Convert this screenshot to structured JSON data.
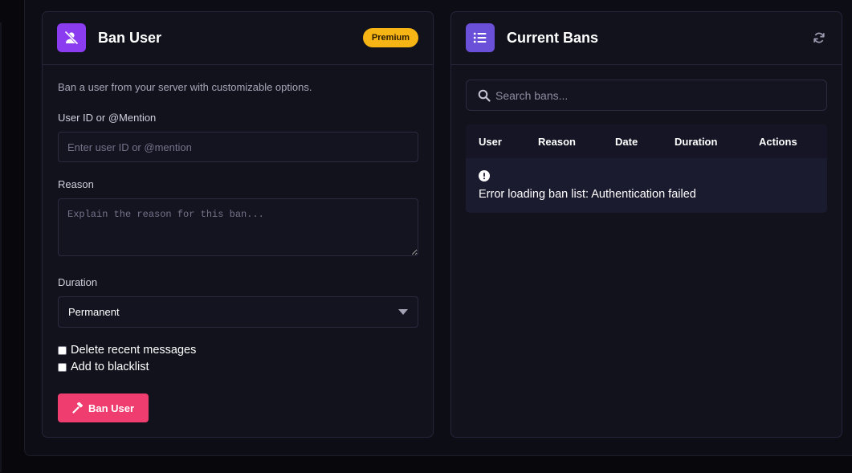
{
  "ban_card": {
    "title": "Ban User",
    "badge": "Premium",
    "description": "Ban a user from your server with customizable options.",
    "user_label": "User ID or @Mention",
    "user_placeholder": "Enter user ID or @mention",
    "reason_label": "Reason",
    "reason_placeholder": "Explain the reason for this ban...",
    "duration_label": "Duration",
    "duration_value": "Permanent",
    "checkboxes": [
      {
        "label": "Delete recent messages",
        "checked": false
      },
      {
        "label": "Add to blacklist",
        "checked": false
      }
    ],
    "submit_label": "Ban User",
    "icon": "user-slash-icon"
  },
  "bans_card": {
    "title": "Current Bans",
    "icon": "list-icon",
    "search_placeholder": "Search bans...",
    "columns": [
      "User",
      "Reason",
      "Date",
      "Duration",
      "Actions"
    ],
    "error_message": "Error loading ban list: Authentication failed"
  },
  "colors": {
    "accent_purple": "#8b3cf0",
    "list_purple": "#6a4fd8",
    "premium": "#f6b415",
    "danger": "#ef3d6f"
  }
}
